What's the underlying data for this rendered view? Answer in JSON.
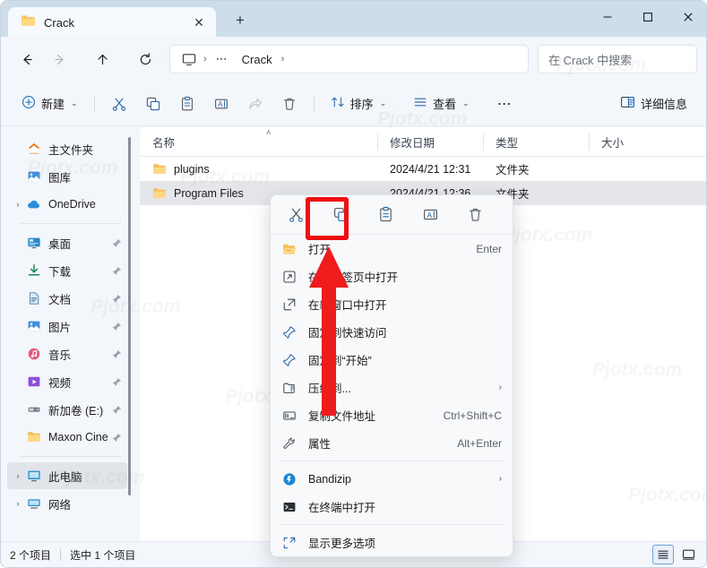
{
  "window": {
    "tab_title": "Crack",
    "tab_icon": "folder-icon",
    "close_tab_glyph": "✕",
    "new_tab_glyph": "+",
    "minimize_label": "—",
    "maximize_label": "□",
    "close_label": "✕"
  },
  "nav": {
    "back": "←",
    "forward": "→",
    "up": "↑",
    "refresh": "⟳",
    "breadcrumb": [
      {
        "label": "",
        "icon": "monitor-icon"
      },
      {
        "label": "⋯",
        "icon": "ellipsis"
      },
      {
        "label": "Crack",
        "icon": ""
      }
    ],
    "separator": "›",
    "search_placeholder": "在 Crack 中搜索"
  },
  "toolbar": {
    "new_label": "新建",
    "cut_label": "剪切",
    "copy_label": "复制",
    "paste_label": "粘贴",
    "rename_label": "重命名",
    "share_label": "共享",
    "delete_label": "删除",
    "sort_label": "排序",
    "view_label": "查看",
    "more_label": "⋯",
    "details_label": "详细信息",
    "chevron": "⌄"
  },
  "sidebar": {
    "items": [
      {
        "label": "主文件夹",
        "icon": "home-icon",
        "chevron": false,
        "pinned": false,
        "selected": false
      },
      {
        "label": "图库",
        "icon": "gallery-icon",
        "chevron": false,
        "pinned": false,
        "selected": false
      },
      {
        "label": "OneDrive",
        "icon": "cloud-icon",
        "chevron": true,
        "pinned": false,
        "selected": false
      },
      {
        "divider": true
      },
      {
        "label": "桌面",
        "icon": "desktop-icon",
        "chevron": false,
        "pinned": true,
        "selected": false
      },
      {
        "label": "下载",
        "icon": "download-icon",
        "chevron": false,
        "pinned": true,
        "selected": false
      },
      {
        "label": "文档",
        "icon": "document-icon",
        "chevron": false,
        "pinned": true,
        "selected": false
      },
      {
        "label": "图片",
        "icon": "picture-icon",
        "chevron": false,
        "pinned": true,
        "selected": false
      },
      {
        "label": "音乐",
        "icon": "music-icon",
        "chevron": false,
        "pinned": true,
        "selected": false
      },
      {
        "label": "视频",
        "icon": "video-icon",
        "chevron": false,
        "pinned": true,
        "selected": false
      },
      {
        "label": "新加卷 (E:)",
        "icon": "drive-icon",
        "chevron": false,
        "pinned": true,
        "selected": false
      },
      {
        "label": "Maxon Cine",
        "icon": "folder-icon",
        "chevron": false,
        "pinned": true,
        "selected": false
      },
      {
        "divider": true
      },
      {
        "label": "此电脑",
        "icon": "pc-icon",
        "chevron": true,
        "pinned": false,
        "selected": true
      },
      {
        "label": "网络",
        "icon": "network-icon",
        "chevron": true,
        "pinned": false,
        "selected": false
      }
    ],
    "chevron_glyph": "›",
    "pin_glyph": "📌"
  },
  "filelist": {
    "columns": [
      {
        "label": "名称",
        "key": "name"
      },
      {
        "label": "修改日期",
        "key": "date"
      },
      {
        "label": "类型",
        "key": "type"
      },
      {
        "label": "大小",
        "key": "size"
      }
    ],
    "sort_indicator": "˄",
    "rows": [
      {
        "name": "plugins",
        "date": "2024/4/21 12:31",
        "type": "文件夹",
        "size": "",
        "icon": "folder-icon",
        "selected": false
      },
      {
        "name": "Program Files",
        "date": "2024/4/21 12:36",
        "type": "文件夹",
        "size": "",
        "icon": "folder-icon",
        "selected": true
      }
    ]
  },
  "contextmenu": {
    "icon_buttons": [
      {
        "name": "cut-icon",
        "label": "剪切",
        "highlighted": false
      },
      {
        "name": "copy-icon",
        "label": "复制",
        "highlighted": true
      },
      {
        "name": "paste-icon",
        "label": "粘贴",
        "highlighted": false
      },
      {
        "name": "rename-icon",
        "label": "重命名",
        "highlighted": false
      },
      {
        "name": "delete-icon",
        "label": "删除",
        "highlighted": false
      }
    ],
    "items": [
      {
        "label": "打开",
        "accel": "Enter",
        "icon": "folder-open-icon",
        "submenu": false
      },
      {
        "label": "在新标签页中打开",
        "accel": "",
        "icon": "new-tab-icon",
        "submenu": false
      },
      {
        "label": "在新窗口中打开",
        "accel": "",
        "icon": "new-window-icon",
        "submenu": false
      },
      {
        "label": "固定到快速访问",
        "accel": "",
        "icon": "pin-icon",
        "submenu": false
      },
      {
        "label": "固定到“开始”",
        "accel": "",
        "icon": "pin-icon",
        "submenu": false
      },
      {
        "label": "压缩到...",
        "accel": "",
        "icon": "archive-icon",
        "submenu": true
      },
      {
        "label": "复制文件地址",
        "accel": "Ctrl+Shift+C",
        "icon": "copy-path-icon",
        "submenu": false
      },
      {
        "label": "属性",
        "accel": "Alt+Enter",
        "icon": "wrench-icon",
        "submenu": false
      },
      {
        "divider": true
      },
      {
        "label": "Bandizip",
        "accel": "",
        "icon": "bandizip-icon",
        "submenu": true
      },
      {
        "label": "在终端中打开",
        "accel": "",
        "icon": "terminal-icon",
        "submenu": false
      },
      {
        "divider": true
      },
      {
        "label": "显示更多选项",
        "accel": "",
        "icon": "more-options-icon",
        "submenu": false
      }
    ],
    "submenu_glyph": "›"
  },
  "statusbar": {
    "item_count": "2 个项目",
    "selection": "选中 1 个项目",
    "view_details_label": "详细信息视图",
    "view_large_label": "大图标视图"
  },
  "annotation": {
    "box_color": "#f00d12",
    "arrow_color": "#ee1c1c",
    "target": "copy-icon"
  },
  "watermarks": [
    "Pjotx.com",
    "Pjotx.com",
    "Pjotx.com",
    "Pjotx.com",
    "Pjotx.com",
    "Pjotx.com",
    "Pjotx.com",
    "Pjotx.com",
    "Pjotx.com",
    "Pjotx.com",
    "Pjotx.com",
    "Pjotx.com"
  ]
}
